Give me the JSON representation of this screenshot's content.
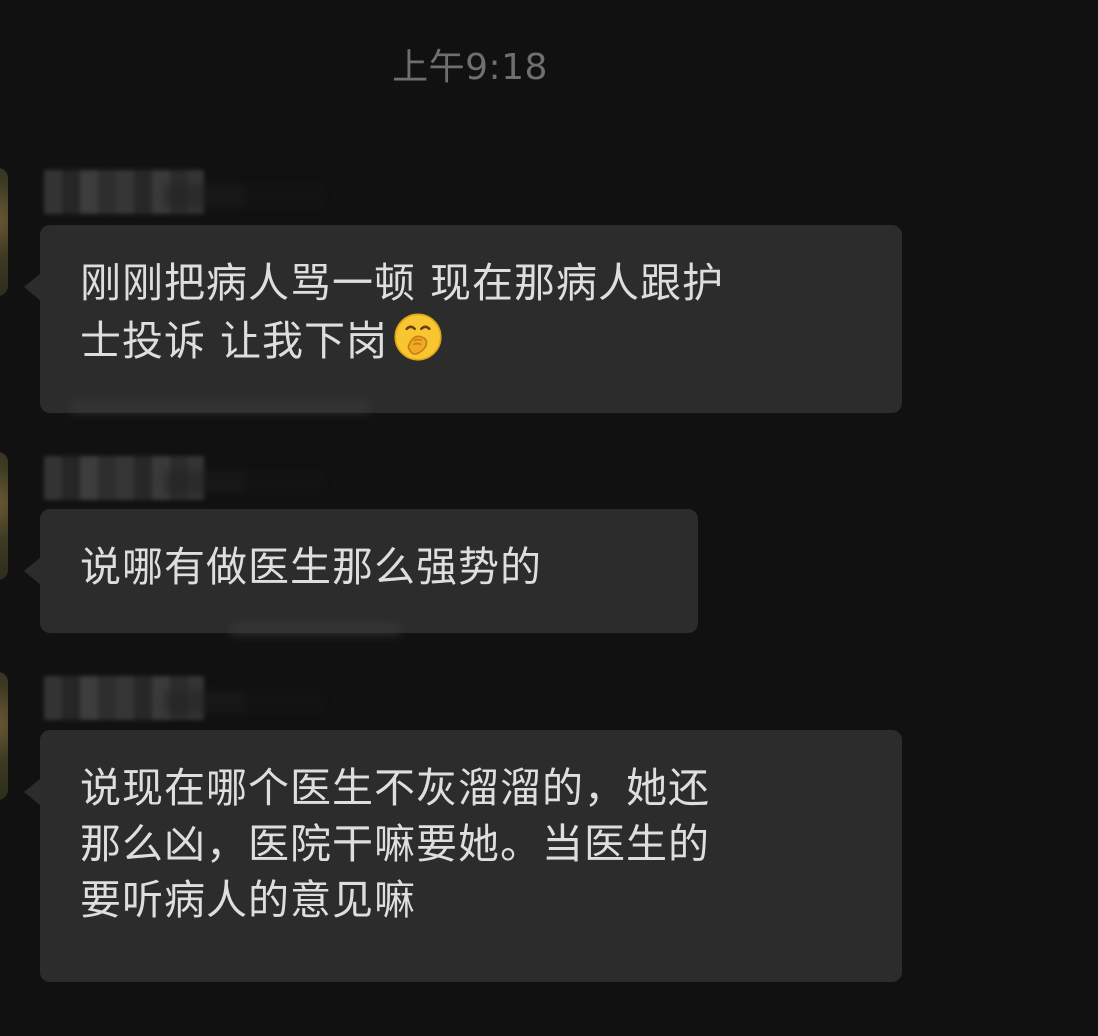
{
  "chat": {
    "timestamp": "上午9:18",
    "messages": [
      {
        "lines": [
          "刚刚把病人骂一顿 现在那病人跟护",
          "士投诉 让我下岗"
        ],
        "emoji": "hand-over-mouth-emoji"
      },
      {
        "lines": [
          "说哪有做医生那么强势的"
        ]
      },
      {
        "lines": [
          "说现在哪个医生不灰溜溜的，她还",
          "那么凶，医院干嘛要她。当医生的",
          "要听病人的意见嘛"
        ]
      }
    ]
  },
  "colors": {
    "background": "#111111",
    "bubble": "#2c2c2c",
    "text": "#dedede",
    "timestamp": "#6f6f6f"
  }
}
